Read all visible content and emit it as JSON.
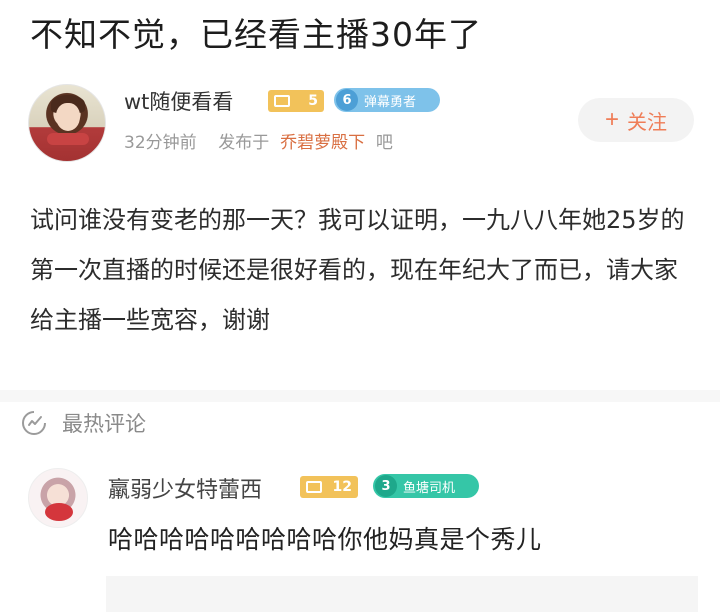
{
  "post": {
    "title": "不知不觉，已经看主播30年了",
    "author": {
      "name": "wt随便看看",
      "level": "5",
      "title_badge_num": "6",
      "title_badge_text": "弹幕勇者"
    },
    "time": "32分钟前",
    "published_in": "发布于",
    "forum": "乔碧萝殿下",
    "forum_suffix": "吧",
    "follow_label": "关注",
    "body": "试问谁没有变老的那一天？我可以证明，一九八八年她25岁的第一次直播的时候还是很好看的，现在年纪大了而已，请大家给主播一些宽容，谢谢"
  },
  "hot_comments": {
    "label": "最热评论"
  },
  "comment": {
    "name": "羸弱少女特蕾西",
    "level": "12",
    "title_badge_num": "3",
    "title_badge_text": "鱼塘司机",
    "text": "哈哈哈哈哈哈哈哈哈你他妈真是个秀儿"
  },
  "colors": {
    "accent": "#ef7d57",
    "forum_link": "#d96f42",
    "level_badge": "#f2c25a",
    "title_badge_blue": "#7ec2ea",
    "title_badge_green": "#35c6a7"
  }
}
